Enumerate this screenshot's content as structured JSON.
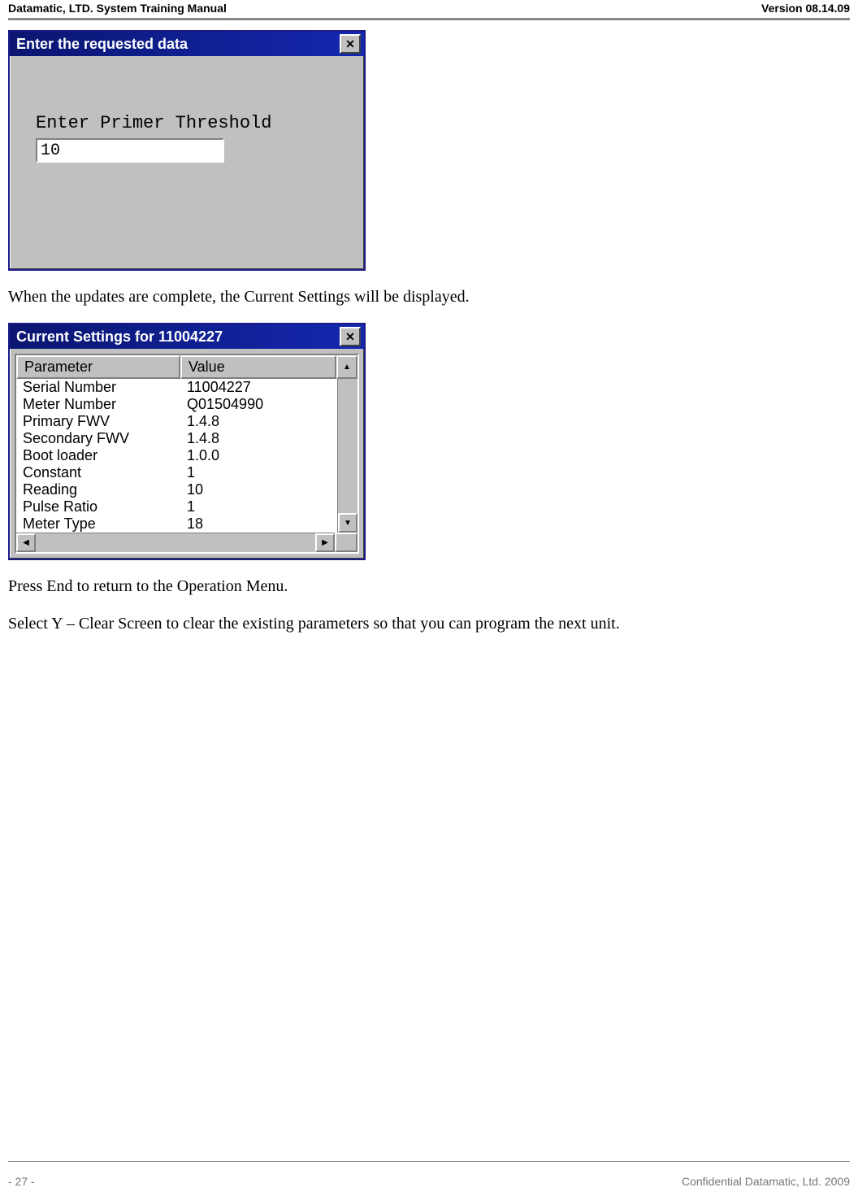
{
  "header": {
    "left": "Datamatic, LTD. System Training  Manual",
    "right": "Version 08.14.09"
  },
  "footer": {
    "left": "- 27 -",
    "right": "Confidential Datamatic, Ltd. 2009"
  },
  "dialog1": {
    "title": "Enter the requested data",
    "label": "Enter Primer Threshold",
    "value": "10",
    "close_glyph": "✕"
  },
  "text1": "When the updates are complete, the Current Settings will be displayed.",
  "dialog2": {
    "title": "Current Settings for 11004227",
    "close_glyph": "✕",
    "header_param": "Parameter",
    "header_value": "Value",
    "up_arrow": "▲",
    "down_arrow": "▼",
    "left_arrow": "◀",
    "right_arrow": "▶",
    "rows": [
      {
        "param": "Serial Number",
        "value": "11004227"
      },
      {
        "param": "Meter Number",
        "value": "Q01504990"
      },
      {
        "param": "Primary FWV",
        "value": "1.4.8"
      },
      {
        "param": "Secondary FWV",
        "value": "1.4.8"
      },
      {
        "param": "Boot loader",
        "value": "1.0.0"
      },
      {
        "param": "Constant",
        "value": "1"
      },
      {
        "param": "Reading",
        "value": "10"
      },
      {
        "param": "Pulse Ratio",
        "value": "1"
      },
      {
        "param": "Meter Type",
        "value": "18"
      }
    ]
  },
  "text2": "Press End to return to the Operation Menu.",
  "text3": "Select Y – Clear Screen to clear the existing parameters so that you can program the next unit."
}
